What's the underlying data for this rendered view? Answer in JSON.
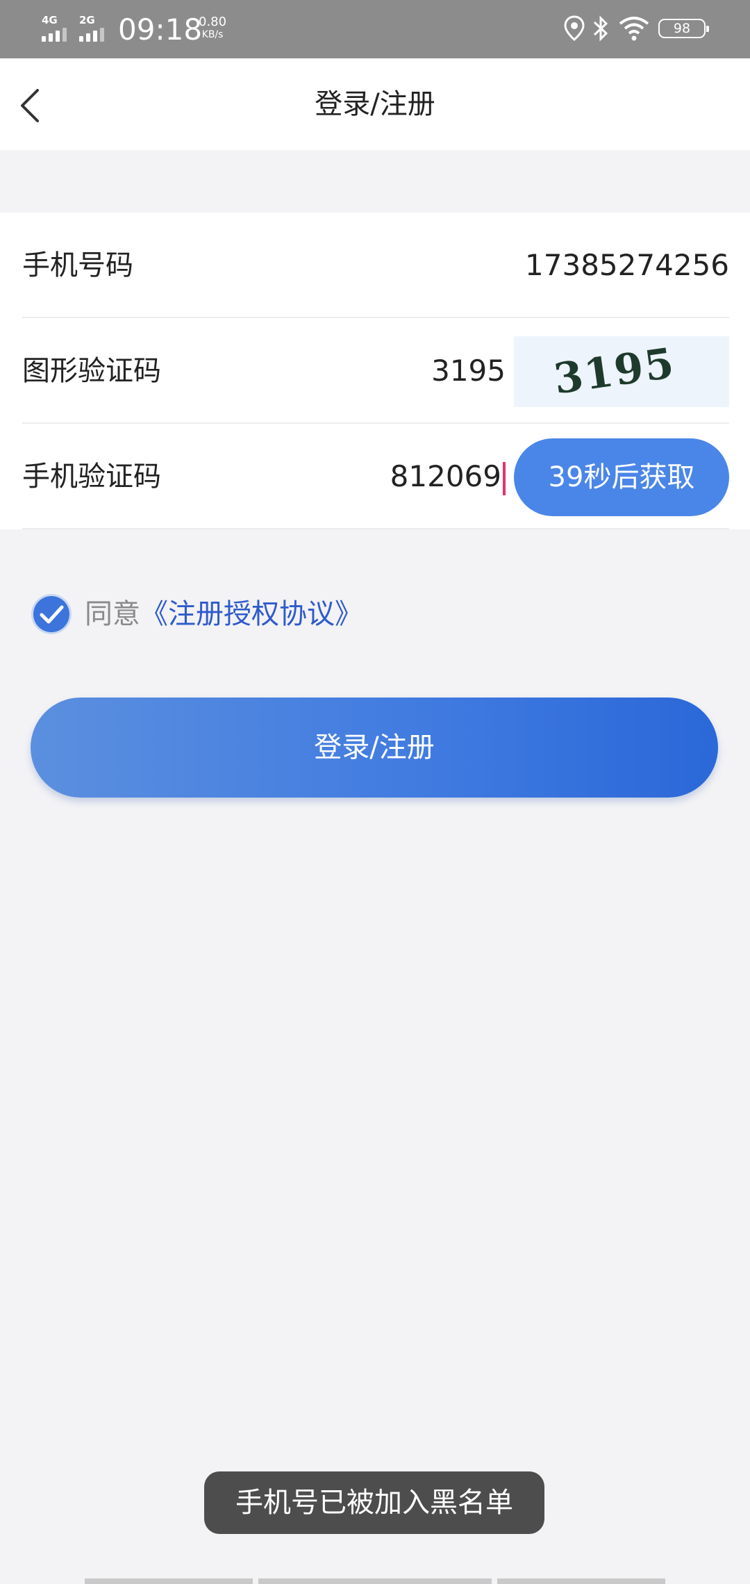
{
  "status_bar": {
    "network1": "4G",
    "network2": "2G",
    "time": "09:18",
    "speed_value": "0.80",
    "speed_unit": "KB/s",
    "battery": "98",
    "icons": [
      "location-icon",
      "bluetooth-icon",
      "wifi-icon",
      "battery-icon"
    ]
  },
  "nav": {
    "title": "登录/注册",
    "back_icon": "back-chevron-icon"
  },
  "form": {
    "phone_label": "手机号码",
    "phone_value": "17385274256",
    "captcha_label": "图形验证码",
    "captcha_value": "3195",
    "captcha_image_text": "3195",
    "sms_label": "手机验证码",
    "sms_value": "812069",
    "countdown_label": "39秒后获取"
  },
  "agreement": {
    "checked": true,
    "prefix": "同意",
    "link": "《注册授权协议》"
  },
  "login_button": "登录/注册",
  "toast": "手机号已被加入黑名单",
  "colors": {
    "accent": "#4a86e8",
    "link": "#2f5bcc",
    "status_bar": "#8c8c8c"
  }
}
